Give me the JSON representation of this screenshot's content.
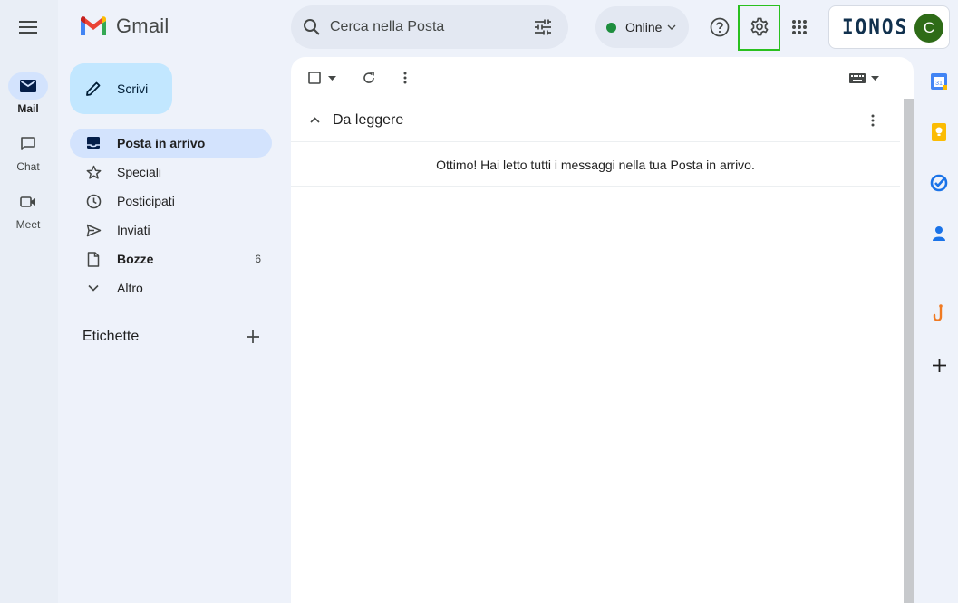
{
  "app": {
    "logo_text": "Gmail"
  },
  "rail": {
    "items": [
      {
        "label": "Mail",
        "icon": "mail-icon",
        "active": true
      },
      {
        "label": "Chat",
        "icon": "chat-icon",
        "active": false
      },
      {
        "label": "Meet",
        "icon": "video-icon",
        "active": false
      }
    ]
  },
  "compose": {
    "label": "Scrivi"
  },
  "nav": {
    "items": [
      {
        "label": "Posta in arrivo",
        "icon": "inbox-icon",
        "active": true,
        "count": ""
      },
      {
        "label": "Speciali",
        "icon": "star-icon",
        "active": false,
        "count": ""
      },
      {
        "label": "Posticipati",
        "icon": "clock-icon",
        "active": false,
        "count": ""
      },
      {
        "label": "Inviati",
        "icon": "send-icon",
        "active": false,
        "count": ""
      },
      {
        "label": "Bozze",
        "icon": "draft-icon",
        "active": false,
        "count": "6"
      },
      {
        "label": "Altro",
        "icon": "chevron-down-icon",
        "active": false,
        "count": ""
      }
    ],
    "labels_title": "Etichette"
  },
  "search": {
    "placeholder": "Cerca nella Posta"
  },
  "status": {
    "label": "Online",
    "color": "#1e8e3e"
  },
  "account": {
    "brand": "IONOS",
    "avatar_letter": "C",
    "avatar_color": "#2e6b17"
  },
  "main": {
    "section_title": "Da leggere",
    "empty_message": "Ottimo! Hai letto tutti i messaggi nella tua Posta in arrivo."
  },
  "colors": {
    "accent": "#c2e7ff",
    "active_nav": "#d3e3fd",
    "highlight_box": "#2ac01f"
  }
}
